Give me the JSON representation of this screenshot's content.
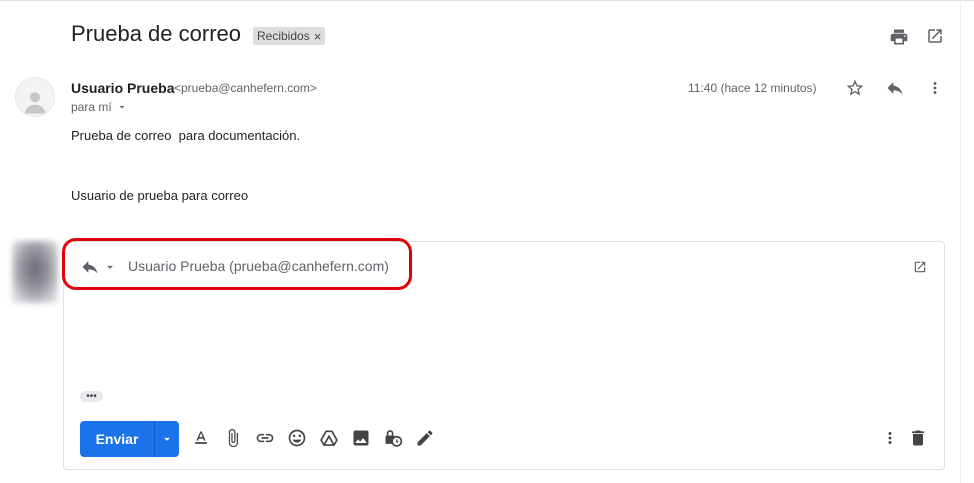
{
  "email": {
    "subject": "Prueba de correo",
    "label": "Recibidos",
    "label_remove": "×",
    "sender_name": "Usuario Prueba",
    "sender_email": "<prueba@canhefern.com>",
    "to": "para mí",
    "timestamp": "11:40 (hace 12 minutos)",
    "body_line1": "Prueba de correo  para documentación.",
    "body_line2": "Usuario de prueba para correo"
  },
  "reply": {
    "recipient": "Usuario Prueba (prueba@canhefern.com)",
    "show_trimmed": "•••",
    "send_label": "Enviar"
  },
  "colors": {
    "send_button": "#1a73e8",
    "highlight": "#e0000b",
    "label_chip": "#dddddd"
  },
  "icons": {
    "header": [
      "print-icon",
      "open-in-new-window-icon"
    ],
    "message": [
      "star-icon",
      "reply-icon",
      "more-vert-icon"
    ],
    "compose_toolbar": [
      "text-format-icon",
      "attach-icon",
      "link-icon",
      "emoji-icon",
      "drive-icon",
      "photo-icon",
      "confidential-mode-icon",
      "signature-icon"
    ],
    "compose_right": [
      "more-options-icon",
      "discard-icon"
    ]
  }
}
